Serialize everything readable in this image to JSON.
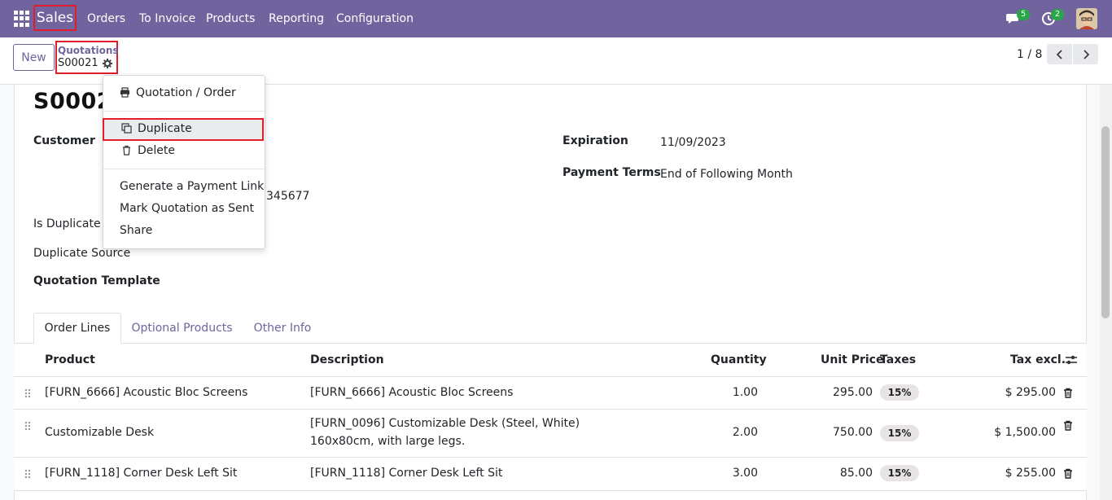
{
  "navbar": {
    "brand": "Sales",
    "menu": [
      "Orders",
      "To Invoice",
      "Products",
      "Reporting",
      "Configuration"
    ],
    "messages_count": "5",
    "activities_count": "2"
  },
  "control_panel": {
    "new_label": "New",
    "breadcrumb_parent": "Quotations",
    "breadcrumb_current": "S00021",
    "pager": "1 / 8"
  },
  "form": {
    "title": "S00021",
    "customer_label": "Customer",
    "phone_fragment": "345677",
    "is_duplicate_label": "Is Duplicate",
    "duplicate_source_label": "Duplicate Source",
    "quotation_template_label": "Quotation Template",
    "expiration_label": "Expiration",
    "expiration_value": "11/09/2023",
    "payment_terms_label": "Payment Terms",
    "payment_terms_value": "End of Following Month"
  },
  "tabs": [
    "Order Lines",
    "Optional Products",
    "Other Info"
  ],
  "table": {
    "headers": {
      "product": "Product",
      "description": "Description",
      "quantity": "Quantity",
      "unit_price": "Unit Price",
      "taxes": "Taxes",
      "tax_excl": "Tax excl."
    },
    "rows": [
      {
        "product": "[FURN_6666] Acoustic Bloc Screens",
        "description": "[FURN_6666] Acoustic Bloc Screens",
        "description2": "",
        "quantity": "1.00",
        "unit_price": "295.00",
        "tax": "15%",
        "subtotal": "$ 295.00"
      },
      {
        "product": "Customizable Desk",
        "description": "[FURN_0096] Customizable Desk (Steel, White)",
        "description2": "160x80cm, with large legs.",
        "quantity": "2.00",
        "unit_price": "750.00",
        "tax": "15%",
        "subtotal": "$ 1,500.00"
      },
      {
        "product": "[FURN_1118] Corner Desk Left Sit",
        "description": "[FURN_1118] Corner Desk Left Sit",
        "description2": "",
        "quantity": "3.00",
        "unit_price": "85.00",
        "tax": "15%",
        "subtotal": "$ 255.00"
      }
    ]
  },
  "dropdown": {
    "print": "Quotation / Order",
    "duplicate": "Duplicate",
    "delete": "Delete",
    "payment_link": "Generate a Payment Link",
    "mark_sent": "Mark Quotation as Sent",
    "share": "Share"
  },
  "colors": {
    "brand": "#71639e",
    "highlight": "#e11d2b",
    "badge": "#28a745"
  }
}
